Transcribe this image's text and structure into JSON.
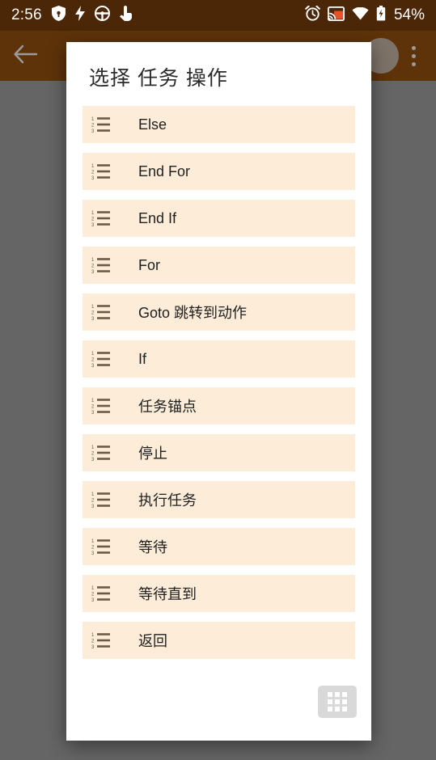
{
  "status_bar": {
    "time": "2:56",
    "battery_percent": "54%",
    "left_icons": [
      "shield-icon",
      "bolt-icon",
      "steering-wheel-icon",
      "touch-pointer-icon"
    ],
    "right_icons": [
      "alarm-clock-icon",
      "cast-icon",
      "wifi-icon",
      "battery-icon"
    ],
    "background_color": "#4b2607",
    "foreground_color": "#ffffff",
    "cast_accent_color": "#e8522a"
  },
  "toolbar": {
    "back_icon": "arrow-left-icon",
    "ghost_title": "",
    "overflow_icon": "kebab-menu-icon",
    "fab_icon": "circle-button",
    "background_color": "#5e330a"
  },
  "dialog": {
    "title": "选择 任务 操作",
    "background_color": "#ffffff",
    "row_background_color": "#fcecd8",
    "options": [
      {
        "label": "Else",
        "icon": "numbered-list-icon"
      },
      {
        "label": "End For",
        "icon": "numbered-list-icon"
      },
      {
        "label": "End If",
        "icon": "numbered-list-icon"
      },
      {
        "label": "For",
        "icon": "numbered-list-icon"
      },
      {
        "label": "Goto 跳转到动作",
        "icon": "numbered-list-icon"
      },
      {
        "label": "If",
        "icon": "numbered-list-icon"
      },
      {
        "label": "任务锚点",
        "icon": "numbered-list-icon"
      },
      {
        "label": "停止",
        "icon": "numbered-list-icon"
      },
      {
        "label": "执行任务",
        "icon": "numbered-list-icon"
      },
      {
        "label": "等待",
        "icon": "numbered-list-icon"
      },
      {
        "label": "等待直到",
        "icon": "numbered-list-icon"
      },
      {
        "label": "返回",
        "icon": "numbered-list-icon"
      }
    ],
    "footer_button": {
      "icon": "grid-apps-icon",
      "label": ""
    }
  },
  "scrim": {
    "color": "#656565"
  }
}
